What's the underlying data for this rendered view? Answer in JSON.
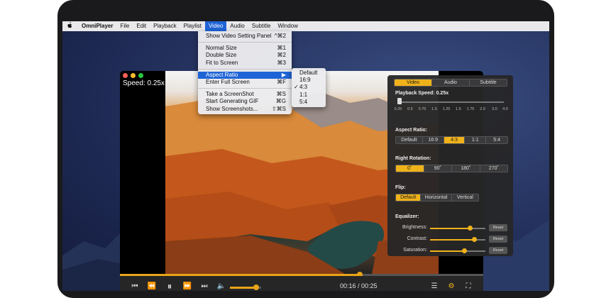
{
  "menubar": {
    "apple": "",
    "app_name": "OmniPlayer",
    "items": [
      "File",
      "Edit",
      "Playback",
      "Playlist",
      "Video",
      "Audio",
      "Subtitle",
      "Window"
    ],
    "active": "Video"
  },
  "video_menu": {
    "items": [
      {
        "label": "Show Video Setting Panel",
        "shortcut": "^⌘2"
      },
      {
        "label": "Normal Size",
        "shortcut": "⌘1"
      },
      {
        "label": "Double Size",
        "shortcut": "⌘2"
      },
      {
        "label": "Fit to Screen",
        "shortcut": "⌘3"
      },
      {
        "label": "Aspect Ratio",
        "shortcut": "▶"
      },
      {
        "label": "Enter Full Screen",
        "shortcut": "⌘F"
      },
      {
        "label": "Take a ScreenShot",
        "shortcut": "⌘S"
      },
      {
        "label": "Start Generating GIF",
        "shortcut": "⌘G"
      },
      {
        "label": "Show Screenshots...",
        "shortcut": "⇧⌘S"
      }
    ],
    "highlighted": "Aspect Ratio"
  },
  "aspect_submenu": {
    "items": [
      "Default",
      "16:9",
      "4:3",
      "1:1",
      "5:4"
    ],
    "checked": "4:3",
    "check_mark": "✓"
  },
  "player": {
    "speed_label": "Speed: 0.25x",
    "traffic_lights": [
      "#ff5f57",
      "#febc2e",
      "#28c840"
    ],
    "progress_fraction": 0.66,
    "volume_fraction": 0.83,
    "time": "00:16 / 00:25",
    "icons": {
      "prev": "⏮",
      "rewind": "⏪",
      "pause": "⏸",
      "forward": "⏩",
      "next": "⏭",
      "volume": "🔈",
      "playlist": "☰",
      "settings": "⚙",
      "fullscreen": "⛶"
    }
  },
  "settings_panel": {
    "tabs": [
      "Video",
      "Audio",
      "Subtitle"
    ],
    "selected_tab": "Video",
    "playback_speed_label": "Playback Speed: 0.25x",
    "speed_ticks": [
      "0.25",
      "0.5",
      "0.75",
      "1.0",
      "1.25",
      "1.5",
      "1.75",
      "2.0",
      "3.0",
      "4.0"
    ],
    "aspect_label": "Aspect Ratio:",
    "aspect_options": [
      "Default",
      "16:9",
      "4:3",
      "1:1",
      "5:4"
    ],
    "aspect_selected": "4:3",
    "rotation_label": "Right Rotation:",
    "rotation_options": [
      "0˚",
      "90˚",
      "180˚",
      "270˚"
    ],
    "rotation_selected": "0˚",
    "flip_label": "Flip:",
    "flip_options": [
      "Default",
      "Horizontal",
      "Vertical"
    ],
    "flip_selected": "Default",
    "equalizer_label": "Equalizer:",
    "equalizer": [
      {
        "label": "Brightness:",
        "value": 0.72,
        "reset": "Reset"
      },
      {
        "label": "Contrast:",
        "value": 0.8,
        "reset": "Reset"
      },
      {
        "label": "Saturation:",
        "value": 0.62,
        "reset": "Reset"
      }
    ]
  },
  "colors": {
    "accent": "#f0b21a",
    "menu_highlight": "#1f64d6"
  }
}
